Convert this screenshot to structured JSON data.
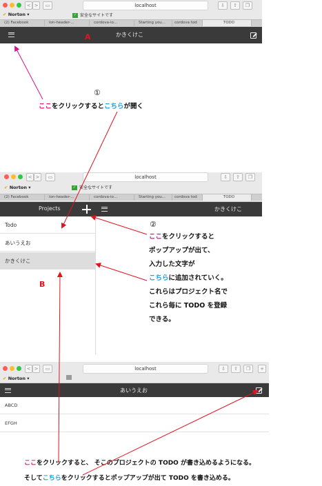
{
  "browser": {
    "norton": "Norton",
    "safe_site": "安全なサイトです",
    "url": "localhost",
    "top_tabs": [
      "(2) Facebook",
      "ion-header-...",
      "cordova-io...",
      "Starting you...",
      "cordova tod",
      "TODO"
    ],
    "mid_tabs": [
      "(2) Facebook",
      "ion-header-...",
      "cordova-io...",
      "Starting you...",
      "cordova tod",
      "TODO"
    ]
  },
  "shot1": {
    "title": "かきくけこ"
  },
  "shot2": {
    "projects_label": "Projects",
    "title": "かきくけこ",
    "projects": [
      "Todo",
      "あいうえお",
      "かきくけこ"
    ]
  },
  "shot3": {
    "title": "あいうえお",
    "todos": [
      "ABCD",
      "EFGH"
    ]
  },
  "annotations": {
    "label_a": "A",
    "label_b": "B",
    "circled_1": "①",
    "circled_2": "②",
    "note1_pink": "ここ",
    "note1_mid": "をクリックすると",
    "note1_blue": "こちら",
    "note1_end": "が開く",
    "note2_line1_pink": "ここ",
    "note2_line1_end": "をクリックすると",
    "note2_line2": "ポップアップが出て、",
    "note2_line3": "入力した文字が",
    "note2_line4_blue": "こちら",
    "note2_line4_end": "に追加されていく。",
    "note2_line5": "これらはプロジェクト名で",
    "note2_line6": "これら毎に TODO を登録",
    "note2_line7": "できる。",
    "note3_line1_pink": "ここ",
    "note3_line1_end": "をクリックすると、 そこのプロジェクトの TODO が書き込めるようになる。",
    "note3_line2_start": "そして",
    "note3_line2_blue": "こちら",
    "note3_line2_end": "をクリックするとポップアップが出て TODO を書き込める。"
  },
  "colors": {
    "pink": "#e0157a",
    "blue": "#1a9fe0",
    "red": "#e0141f",
    "appbar": "#3a3a3a"
  }
}
